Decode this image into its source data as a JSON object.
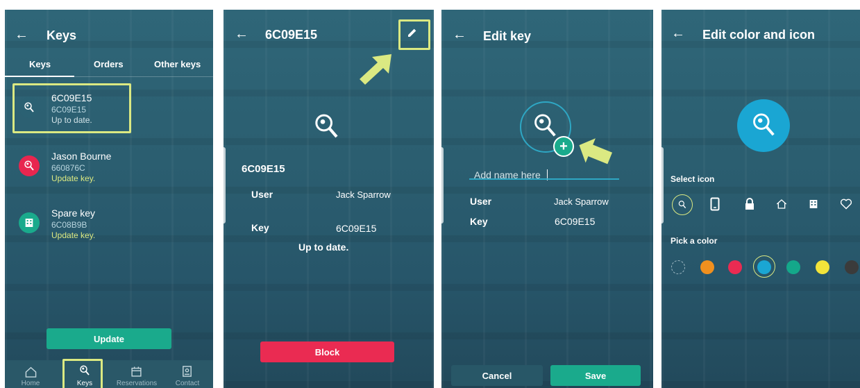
{
  "screen1": {
    "title": "Keys",
    "tabs": [
      "Keys",
      "Orders",
      "Other keys"
    ],
    "keys": [
      {
        "name": "6C09E15",
        "code": "6C09E15",
        "status": "Up to date.",
        "color": "#2b6173"
      },
      {
        "name": "Jason Bourne",
        "code": "660876C",
        "status": "Update key.",
        "color": "#e8264f"
      },
      {
        "name": "Spare key",
        "code": "6C08B9B",
        "status": "Update key.",
        "color": "#1aaa8c"
      }
    ],
    "update_label": "Update",
    "nav": [
      "Home",
      "Keys",
      "Reservations",
      "Contact"
    ]
  },
  "screen2": {
    "title": "6C09E15",
    "key_heading": "6C09E15",
    "user_label": "User",
    "user_value": "Jack Sparrow",
    "key_label": "Key",
    "key_value": "6C09E15",
    "status": "Up to date.",
    "block_label": "Block"
  },
  "screen3": {
    "title": "Edit key",
    "name_placeholder": "Add name here",
    "user_label": "User",
    "user_value": "Jack Sparrow",
    "key_label": "Key",
    "key_value": "6C09E15",
    "cancel_label": "Cancel",
    "save_label": "Save"
  },
  "screen4": {
    "title": "Edit color and icon",
    "select_icon_label": "Select icon",
    "icons": [
      "key-icon",
      "phone-icon",
      "lock-icon",
      "home-icon",
      "building-icon",
      "heart-icon"
    ],
    "pick_color_label": "Pick a color",
    "colors": [
      "transparent",
      "#f0901e",
      "#ea2b52",
      "#1aa6d3",
      "#14a88a",
      "#f3e43a",
      "#3b3b3b"
    ],
    "selected_color": "#1aa6d3"
  },
  "colors": {
    "highlight": "#dbe982",
    "accent_green": "#1aaa8c",
    "accent_red": "#ea2b52",
    "accent_blue": "#1aa6d3",
    "underline": "#2ea7c4"
  }
}
